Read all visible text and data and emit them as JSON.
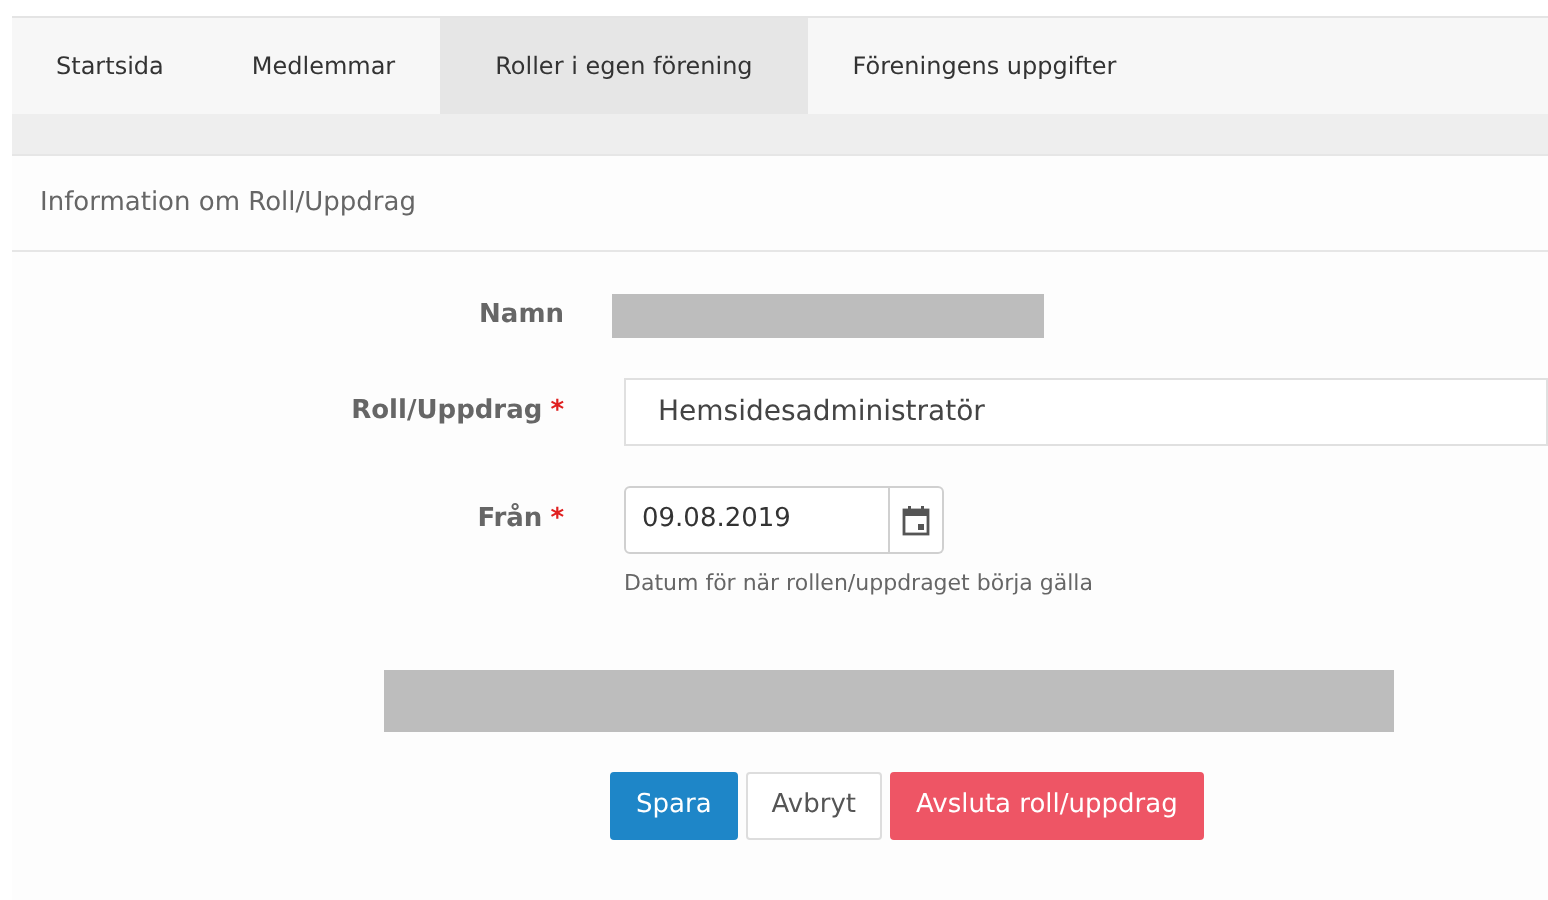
{
  "tabs": [
    {
      "label": "Startsida",
      "selected": false
    },
    {
      "label": "Medlemmar",
      "selected": false
    },
    {
      "label": "Roller i egen förening",
      "selected": true
    },
    {
      "label": "Föreningens uppgifter",
      "selected": false
    }
  ],
  "panel": {
    "title": "Information om Roll/Uppdrag"
  },
  "fields": [
    {
      "kind": "redacted",
      "label": "Namn"
    },
    {
      "kind": "text",
      "label": "Roll/Uppdrag",
      "required_mark": "*",
      "value": "Hemsidesadministratör"
    },
    {
      "kind": "date",
      "label": "Från",
      "required_mark": "*",
      "value": "09.08.2019",
      "help": "Datum för när rollen/uppdraget börja gälla"
    }
  ],
  "notice": {
    "kind": "redacted"
  },
  "buttons": [
    {
      "kind": "primary",
      "label": "Spara"
    },
    {
      "kind": "default",
      "label": "Avbryt"
    },
    {
      "kind": "danger",
      "label": "Avsluta roll/uppdrag"
    }
  ]
}
